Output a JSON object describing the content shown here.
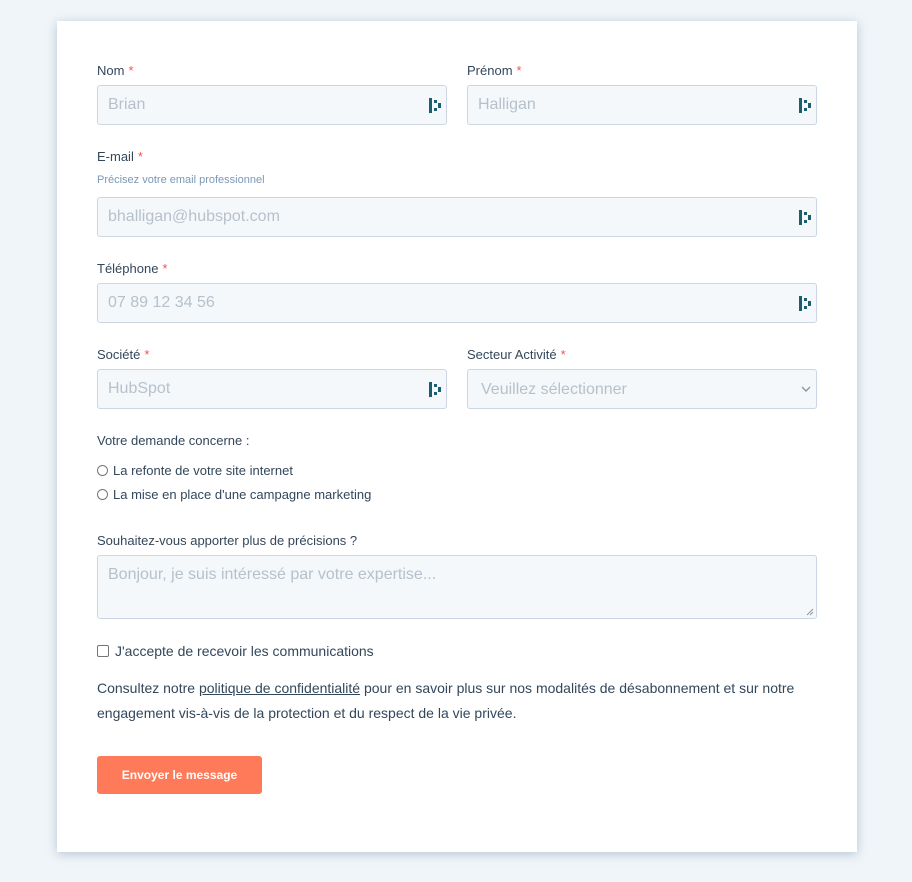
{
  "form": {
    "nom": {
      "label": "Nom",
      "required_mark": "*",
      "placeholder": "Brian"
    },
    "prenom": {
      "label": "Prénom",
      "required_mark": "*",
      "placeholder": "Halligan"
    },
    "email": {
      "label": "E-mail",
      "required_mark": "*",
      "hint": "Précisez votre email professionnel",
      "placeholder": "bhalligan@hubspot.com"
    },
    "telephone": {
      "label": "Téléphone",
      "required_mark": "*",
      "placeholder": "07 89 12 34 56"
    },
    "societe": {
      "label": "Société",
      "required_mark": "*",
      "placeholder": "HubSpot"
    },
    "secteur": {
      "label": "Secteur Activité",
      "required_mark": "*",
      "selected": "Veuillez sélectionner"
    },
    "demande": {
      "label": "Votre demande concerne :",
      "options": [
        "La refonte de votre site internet",
        "La mise en place d'une campagne marketing"
      ]
    },
    "precisions": {
      "label": "Souhaitez-vous apporter plus de précisions ?",
      "placeholder": "Bonjour, je suis intéressé par votre expertise..."
    },
    "consent": {
      "label": "J'accepte de recevoir les communications"
    },
    "legal": {
      "before": "Consultez notre ",
      "link": "politique de confidentialité",
      "after": " pour en savoir plus sur nos modalités de désabonnement et sur notre engagement vis-à-vis de la protection et du respect de la vie privée."
    },
    "submit_label": "Envoyer le message"
  },
  "colors": {
    "page_background": "#f0f5f9",
    "card_background": "#ffffff",
    "input_background": "#f5f8fa",
    "input_border": "#cbd6e2",
    "required_red": "#f2545b",
    "hint_text": "#7c98b6",
    "button_orange": "#ff7a59",
    "lastpass_icon": "#1b5e6f"
  },
  "icons": {
    "autofill": "lastpass-icon",
    "select": "chevron-down-icon"
  }
}
